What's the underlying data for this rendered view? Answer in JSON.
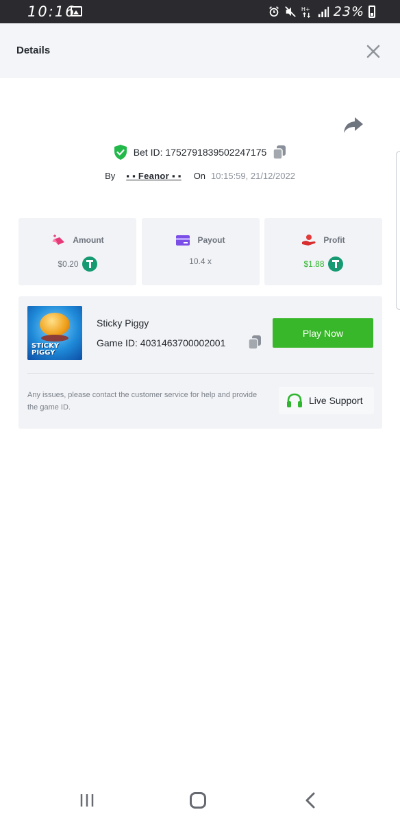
{
  "status_bar": {
    "time": "10:16",
    "battery": "23%",
    "icons": [
      "gallery-icon",
      "alarm-icon",
      "mute-icon",
      "data-h-plus-icon",
      "signal-icon",
      "battery-icon"
    ]
  },
  "header": {
    "title": "Details",
    "close_icon": "close-icon"
  },
  "bet": {
    "bet_id_text": "Bet ID: 1752791839502247175",
    "by_label": "By",
    "user": "▪ ▪ Feanor ▪ ▪",
    "on_label": "On",
    "datetime": "10:15:59, 21/12/2022"
  },
  "stats": {
    "amount": {
      "label": "Amount",
      "value": "$0.20",
      "icon": "bet-chips-icon"
    },
    "payout": {
      "label": "Payout",
      "value": "10.4 x",
      "icon": "card-icon"
    },
    "profit": {
      "label": "Profit",
      "value": "$1.88",
      "icon": "hand-coin-icon"
    },
    "currency_icon": "tether-icon"
  },
  "game": {
    "name": "Sticky Piggy",
    "thumbnail_text": "STICKY PIGGY",
    "game_id_text": "Game ID: 4031463700002001",
    "play_label": "Play Now",
    "help_text": "Any issues, please contact the customer service for help and provide the game ID.",
    "support_label": "Live Support"
  },
  "colors": {
    "accent_green": "#39b72a",
    "profit_green": "#2fb52f",
    "tether_green": "#169a72",
    "panel_bg": "#f2f3f6"
  }
}
